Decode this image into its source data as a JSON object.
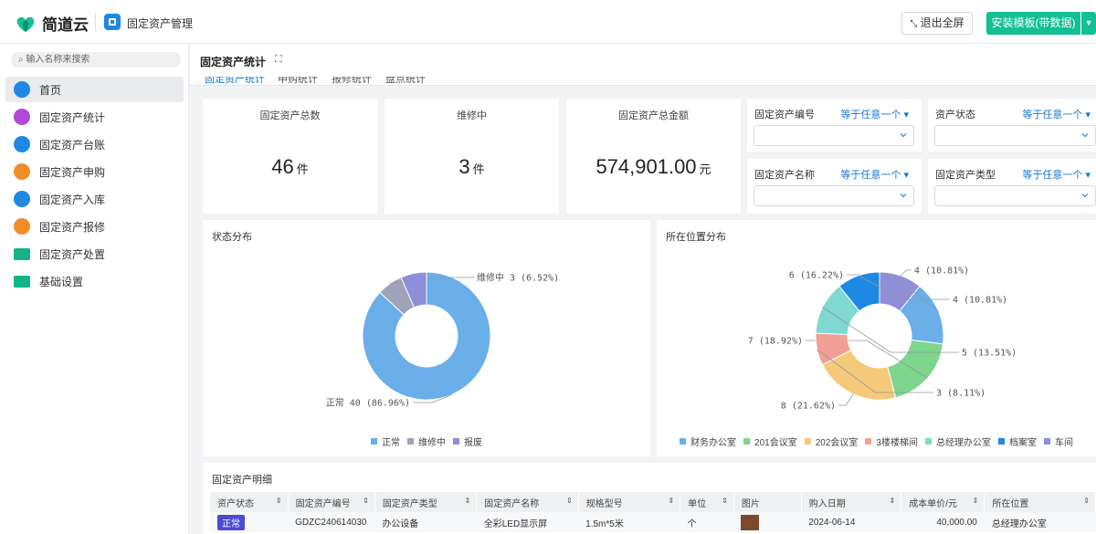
{
  "header": {
    "logo_text": "简道云",
    "app_title": "固定资产管理",
    "exit_fullscreen": "退出全屏",
    "install_template": "安装模板(带数据)"
  },
  "sidebar": {
    "search_placeholder": "输入名称来搜索",
    "items": [
      {
        "label": "首页",
        "icon": "home-icon",
        "color": "#1e88e5"
      },
      {
        "label": "固定资产统计",
        "icon": "chart-icon",
        "color": "#b348d6"
      },
      {
        "label": "固定资产台账",
        "icon": "ledger-icon",
        "color": "#1e88e5"
      },
      {
        "label": "固定资产申购",
        "icon": "purchase-icon",
        "color": "#f28c28"
      },
      {
        "label": "固定资产入库",
        "icon": "stock-in-icon",
        "color": "#1e88e5"
      },
      {
        "label": "固定资产报修",
        "icon": "repair-icon",
        "color": "#f28c28"
      },
      {
        "label": "固定资产处置",
        "icon": "folder-icon",
        "color": "#13b386"
      },
      {
        "label": "基础设置",
        "icon": "folder-icon",
        "color": "#13b386"
      }
    ]
  },
  "page": {
    "title": "固定资产统计",
    "tabs": [
      "固定资产统计",
      "申购统计",
      "报修统计",
      "盘点统计"
    ]
  },
  "kpis": [
    {
      "label": "固定资产总数",
      "value": "46",
      "unit": "件"
    },
    {
      "label": "维修中",
      "value": "3",
      "unit": "件"
    },
    {
      "label": "固定资产总金额",
      "value": "574,901.00",
      "unit": "元"
    }
  ],
  "filters": [
    {
      "label": "固定资产编号",
      "op": "等于任意一个"
    },
    {
      "label": "资产状态",
      "op": "等于任意一个"
    },
    {
      "label": "固定资产名称",
      "op": "等于任意一个"
    },
    {
      "label": "固定资产类型",
      "op": "等于任意一个"
    }
  ],
  "chart_data": [
    {
      "type": "pie",
      "title": "状态分布",
      "categories": [
        "正常",
        "维修中",
        "报废"
      ],
      "values": [
        40,
        3,
        3
      ],
      "labels": [
        "正常 40 (86.96%)",
        "维修中 3 (6.52%)",
        ""
      ],
      "colors": [
        "#6aaeea",
        "#a0a2bc",
        "#8e8fd8"
      ],
      "legend": "bottom"
    },
    {
      "type": "pie",
      "title": "所在位置分布",
      "categories": [
        "车间",
        "财务办公室",
        "201会议室",
        "202会议室",
        "3楼楼梯间",
        "总经理办公室",
        "档案室"
      ],
      "values": [
        4,
        6,
        7,
        8,
        3,
        5,
        4
      ],
      "labels": [
        "4 (10.81%)",
        "6 (16.22%)",
        "7 (18.92%)",
        "8 (21.62%)",
        "3 (8.11%)",
        "5 (13.51%)",
        "4 (10.81%)"
      ],
      "colors": [
        "#8e8fd8",
        "#6aaeea",
        "#7dd58e",
        "#f5c97a",
        "#f29f94",
        "#7fd8d2",
        "#1e88e5"
      ],
      "legend_order": [
        "财务办公室",
        "201会议室",
        "202会议室",
        "3楼楼梯间",
        "总经理办公室",
        "档案室",
        "车间"
      ],
      "legend": "bottom"
    }
  ],
  "table": {
    "title": "固定资产明细",
    "columns": [
      "资产状态",
      "固定资产编号",
      "固定资产类型",
      "固定资产名称",
      "规格型号",
      "单位",
      "图片",
      "购入日期",
      "成本单价/元",
      "所在位置"
    ],
    "rows": [
      [
        "正常",
        "GDZC240614030",
        "办公设备",
        "全彩LED显示屏",
        "1.5m*5米",
        "个",
        "",
        "2024-06-14",
        "40,000.00",
        "总经理办公室"
      ]
    ]
  }
}
